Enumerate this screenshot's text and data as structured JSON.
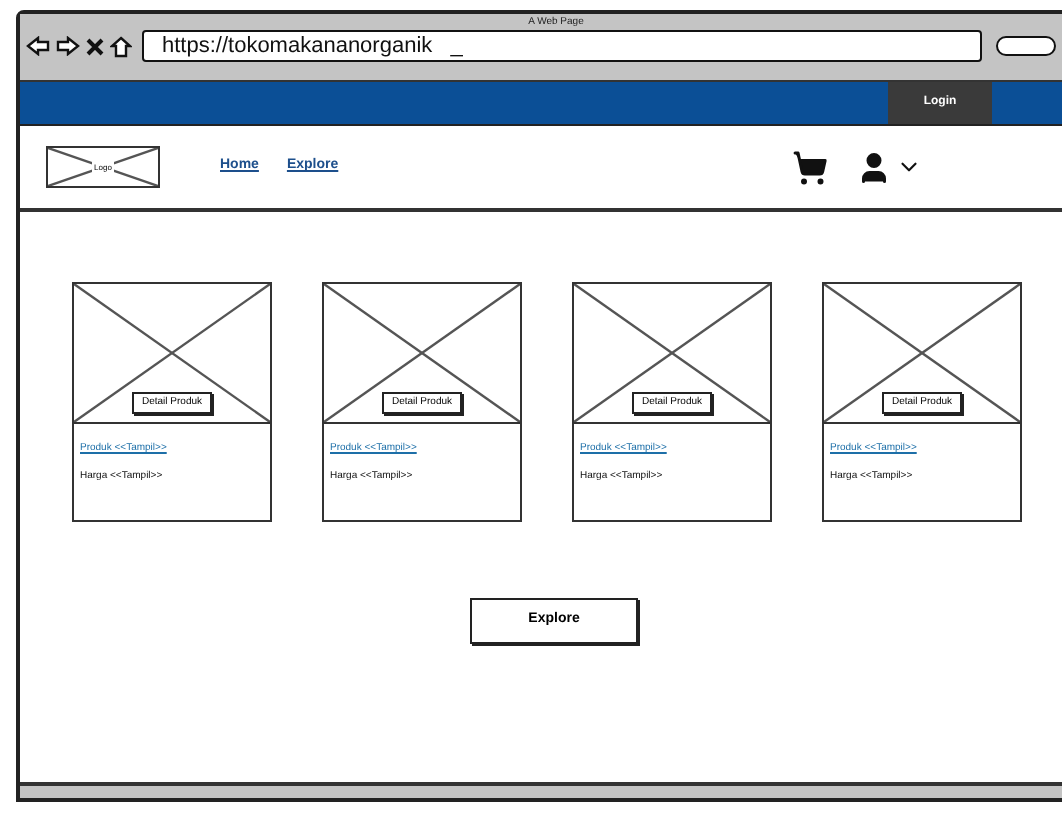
{
  "window": {
    "title": "A Web Page"
  },
  "address_bar": {
    "value": "https://tokomakananorganik   _"
  },
  "top_bar": {
    "login": "Login"
  },
  "header": {
    "logo": "Logo",
    "nav": [
      {
        "label": "Home"
      },
      {
        "label": "Explore"
      }
    ]
  },
  "products": [
    {
      "button": "Detail Produk",
      "name": "Produk <<Tampil>>",
      "price": "Harga <<Tampil>>"
    },
    {
      "button": "Detail Produk",
      "name": "Produk <<Tampil>>",
      "price": "Harga <<Tampil>>"
    },
    {
      "button": "Detail Produk",
      "name": "Produk <<Tampil>>",
      "price": "Harga <<Tampil>>"
    },
    {
      "button": "Detail Produk",
      "name": "Produk <<Tampil>>",
      "price": "Harga <<Tampil>>"
    }
  ],
  "explore_button": "Explore"
}
